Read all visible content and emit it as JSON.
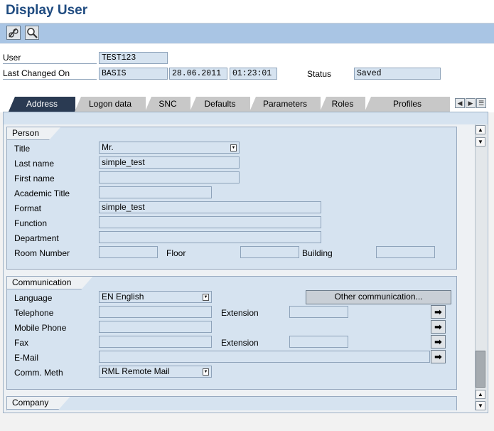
{
  "app": {
    "title": "Display User"
  },
  "toolbar": {
    "buttons": [
      {
        "icon": "glasses-icon"
      },
      {
        "icon": "magnifier-icon"
      }
    ]
  },
  "header": {
    "user_label": "User",
    "user_value": "TEST123",
    "last_changed_label": "Last Changed On",
    "changed_by": "BASIS",
    "changed_date": "28.06.2011",
    "changed_time": "01:23:01",
    "status_label": "Status",
    "status_value": "Saved"
  },
  "tabs": [
    {
      "label": "Address",
      "active": true
    },
    {
      "label": "Logon data"
    },
    {
      "label": "SNC"
    },
    {
      "label": "Defaults"
    },
    {
      "label": "Parameters"
    },
    {
      "label": "Roles"
    },
    {
      "label": "Profiles"
    }
  ],
  "tab_nav": {
    "prev": "◀",
    "next": "▶",
    "list": "☰"
  },
  "person": {
    "section_title": "Person",
    "title_label": "Title",
    "title_value": "Mr.",
    "last_name_label": "Last name",
    "last_name_value": "simple_test",
    "first_name_label": "First name",
    "first_name_value": "",
    "academic_title_label": "Academic Title",
    "academic_title_value": "",
    "format_label": "Format",
    "format_value": "simple_test",
    "function_label": "Function",
    "function_value": "",
    "department_label": "Department",
    "department_value": "",
    "room_label": "Room Number",
    "room_value": "",
    "floor_label": "Floor",
    "floor_value": "",
    "building_label": "Building",
    "building_value": ""
  },
  "communication": {
    "section_title": "Communication",
    "language_label": "Language",
    "language_value": "EN English",
    "other_button": "Other communication...",
    "telephone_label": "Telephone",
    "telephone_value": "",
    "extension_label": "Extension",
    "tel_extension_value": "",
    "mobile_label": "Mobile Phone",
    "mobile_value": "",
    "fax_label": "Fax",
    "fax_value": "",
    "fax_extension_label": "Extension",
    "fax_extension_value": "",
    "email_label": "E-Mail",
    "email_value": "",
    "comm_meth_label": "Comm. Meth",
    "comm_meth_value": "RML Remote Mail",
    "arrow_glyph": "➡"
  },
  "company": {
    "section_title": "Company"
  },
  "scroll": {
    "up": "▲",
    "down": "▼"
  }
}
